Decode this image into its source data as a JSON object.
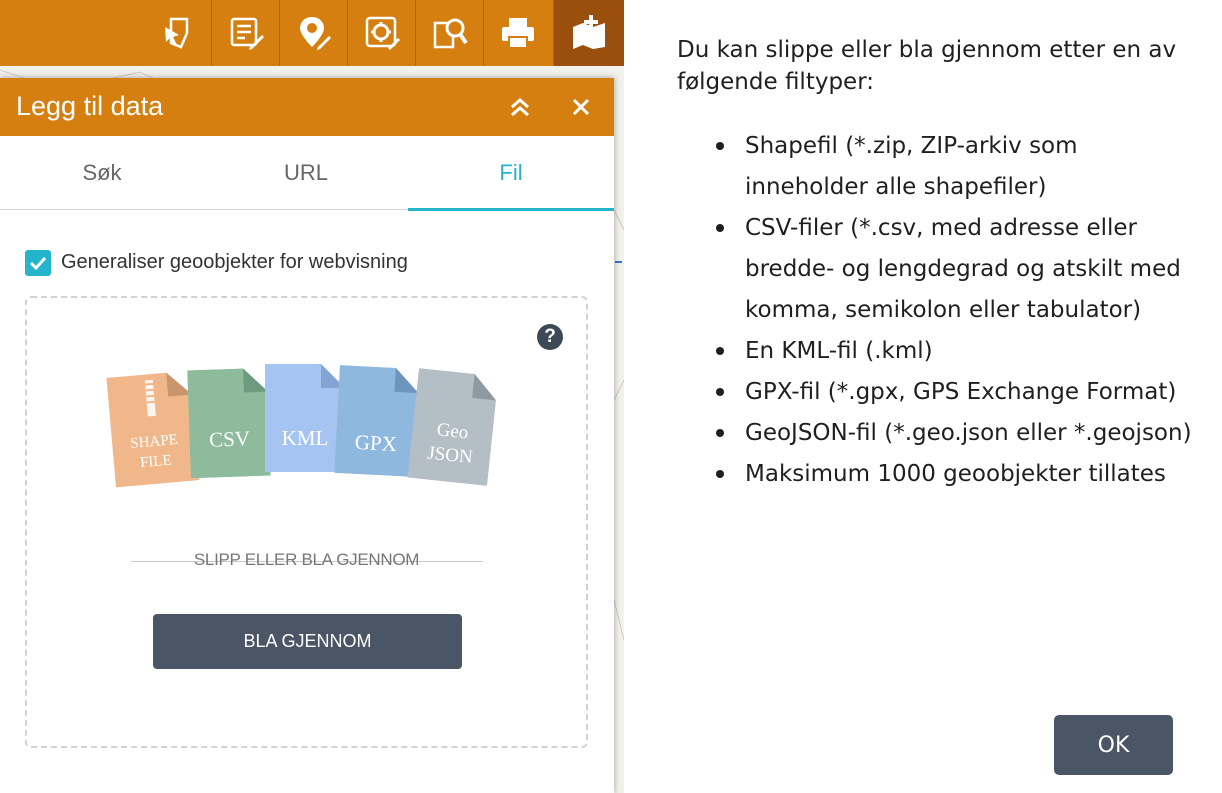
{
  "toolbar": {
    "tools": [
      {
        "icon": "select-icon"
      },
      {
        "icon": "edit-list-icon"
      },
      {
        "icon": "draw-icon"
      },
      {
        "icon": "settings-edit-icon"
      },
      {
        "icon": "search-document-icon"
      },
      {
        "icon": "print-icon"
      },
      {
        "icon": "add-data-icon",
        "active": true
      }
    ]
  },
  "panel": {
    "title": "Legg til data",
    "collapse_icon": "double-chevron-up-icon",
    "close_icon": "close-icon",
    "tabs": [
      {
        "label": "Søk"
      },
      {
        "label": "URL"
      },
      {
        "label": "Fil",
        "active": true
      }
    ],
    "generalize_label": "Generaliser geoobjekter for webvisning",
    "generalize_checked": true,
    "help_label": "?",
    "file_types": [
      {
        "label_line1": "SHAPE",
        "label_line2": "FILE",
        "color": "#f0b88a"
      },
      {
        "label_line1": "CSV",
        "label_line2": "",
        "color": "#8dbb9c"
      },
      {
        "label_line1": "KML",
        "label_line2": "",
        "color": "#a6c4f2"
      },
      {
        "label_line1": "GPX",
        "label_line2": "",
        "color": "#8fb8df"
      },
      {
        "label_line1": "Geo",
        "label_line2": "JSON",
        "color": "#b3bec5"
      }
    ],
    "drop_text": "SLIPP ELLER BLA GJENNOM",
    "browse_label": "BLA GJENNOM"
  },
  "info": {
    "intro": "Du kan slippe eller bla gjennom etter en av følgende filtyper:",
    "items": [
      "Shapefil (*.zip, ZIP-arkiv som inneholder alle shapefiler)",
      "CSV-filer (*.csv, med adresse eller bredde- og lengdegrad og atskilt med komma, semikolon eller tabulator)",
      "En KML-fil (.kml)",
      "GPX-fil (*.gpx, GPS Exchange Format)",
      "GeoJSON-fil (*.geo.json eller *.geojson)",
      "Maksimum 1000 geoobjekter tillates"
    ],
    "ok_label": "OK"
  },
  "colors": {
    "accent_orange": "#d67f11",
    "accent_teal": "#24b5cc",
    "button_dark": "#4a5565"
  }
}
